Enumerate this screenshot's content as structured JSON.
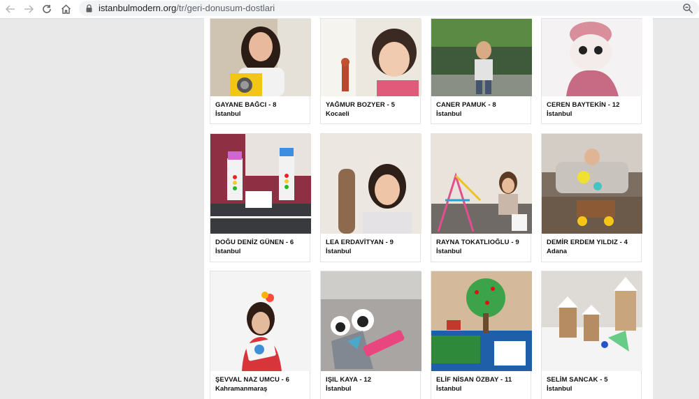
{
  "browser": {
    "url_host": "istanbulmodern.org",
    "url_path": "/tr/geri-donusum-dostlari",
    "icons": {
      "back": "arrow-left",
      "forward": "arrow-right",
      "reload": "reload",
      "home": "home",
      "lock": "lock",
      "zoom": "zoom-out"
    }
  },
  "cards": [
    {
      "name": "GAYANE BAĞCI - 8",
      "city": "İstanbul"
    },
    {
      "name": "YAĞMUR BOZYER - 5",
      "city": "Kocaeli"
    },
    {
      "name": "CANER PAMUK - 8",
      "city": "İstanbul"
    },
    {
      "name": "CEREN BAYTEKİN - 12",
      "city": "İstanbul"
    },
    {
      "name": "DOĞU DENİZ GÜNEN - 6",
      "city": "İstanbul"
    },
    {
      "name": "LEA ERDAVİTYAN - 9",
      "city": "İstanbul"
    },
    {
      "name": "RAYNA TOKATLIOĞLU - 9",
      "city": "İstanbul"
    },
    {
      "name": "DEMİR ERDEM YILDIZ - 4",
      "city": "Adana"
    },
    {
      "name": "ŞEVVAL NAZ UMCU - 6",
      "city": "Kahramanmaraş"
    },
    {
      "name": "IŞIL KAYA - 12",
      "city": "İstanbul"
    },
    {
      "name": "ELİF NİSAN ÖZBAY - 11",
      "city": "İstanbul"
    },
    {
      "name": "SELİM SANCAK - 5",
      "city": "İstanbul"
    }
  ]
}
